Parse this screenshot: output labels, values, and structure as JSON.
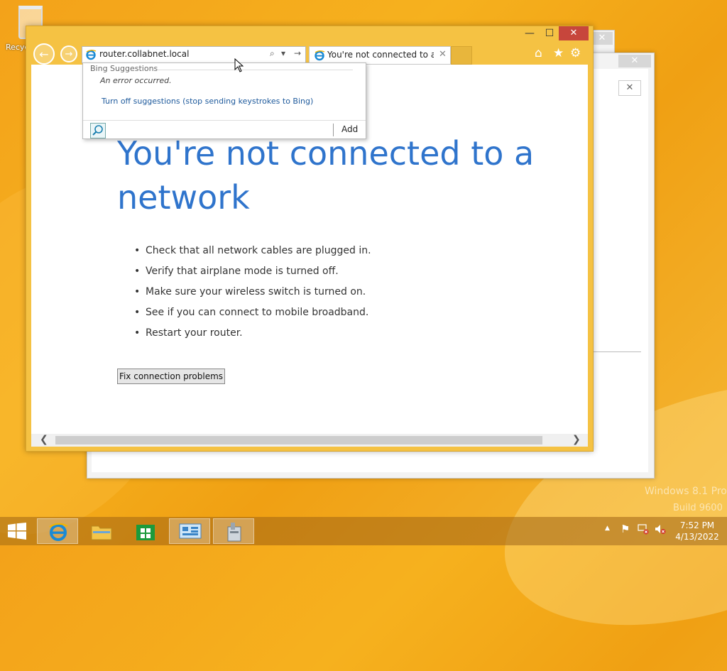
{
  "desktop": {
    "recycle_bin_label": "Recyc",
    "watermark_line1": "Windows 8.1 Pro",
    "watermark_line2": "Build 9600"
  },
  "back_windows": {
    "close_glyph": "✕"
  },
  "browser": {
    "window_controls": {
      "minimize": "—",
      "maximize": "☐",
      "close": "✕"
    },
    "back_glyph": "←",
    "forward_glyph": "→",
    "address": {
      "url": "router.collabnet.local",
      "search_glyph": "⌕",
      "dropdown_glyph": "▾",
      "go_glyph": "→"
    },
    "tab": {
      "title": "You're not connected to a ...",
      "close_glyph": "✕"
    },
    "toolbar": {
      "home_glyph": "⌂",
      "favorites_glyph": "★",
      "settings_glyph": "⚙"
    },
    "suggestions": {
      "header": "Bing Suggestions",
      "error": "An error occurred.",
      "turn_off_link": "Turn off suggestions (stop sending keystrokes to Bing)",
      "add_label": "Add"
    },
    "page": {
      "heading": "You're not connected to a network",
      "bullets": [
        "Check that all network cables are plugged in.",
        "Verify that airplane mode is turned off.",
        "Make sure your wireless switch is turned on.",
        "See if you can connect to mobile broadband.",
        "Restart your router."
      ],
      "fix_button": "Fix connection problems"
    },
    "scroll": {
      "left_glyph": "❮",
      "right_glyph": "❯"
    }
  },
  "taskbar": {
    "items": [
      "internet-explorer",
      "file-explorer",
      "store",
      "control-panel",
      "network-setup"
    ],
    "tray": {
      "expand_glyph": "▲",
      "flag_glyph": "⚑"
    },
    "clock": {
      "time": "7:52 PM",
      "date": "4/13/2022"
    }
  },
  "colors": {
    "accent": "#f5c243",
    "heading": "#2f74cc",
    "close_red": "#c7463c",
    "link": "#1e5a9c"
  }
}
